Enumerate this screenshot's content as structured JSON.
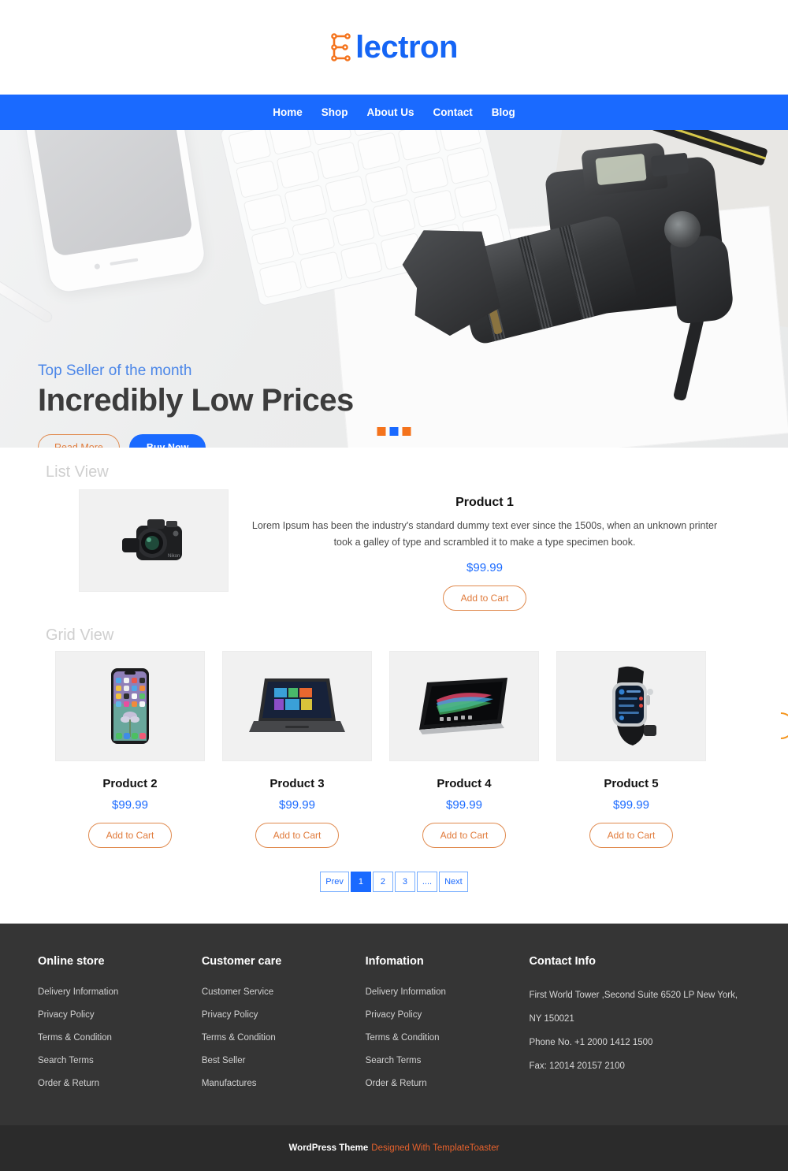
{
  "header": {
    "logo_text": "lectron",
    "logo_icon": "circuit-e-icon"
  },
  "nav": {
    "items": [
      "Home",
      "Shop",
      "About Us",
      "Contact",
      "Blog"
    ]
  },
  "hero": {
    "eyebrow": "Top Seller of the month",
    "title": "Incredibly Low Prices",
    "read_more": "Read More",
    "buy_now": "Buy Now",
    "slides": 3,
    "active_slide": 2
  },
  "list_view": {
    "label": "List View",
    "product": {
      "name": "Product 1",
      "description": "Lorem Ipsum has been the industry's standard dummy text ever since the 1500s, when an unknown printer took a galley of type and scrambled it to make a type specimen book.",
      "price": "$99.99",
      "cart_label": "Add to Cart",
      "image": "dslr-camera-image"
    }
  },
  "grid_view": {
    "label": "Grid View",
    "products": [
      {
        "name": "Product 2",
        "price": "$99.99",
        "cart_label": "Add to Cart",
        "image": "smartphone-image"
      },
      {
        "name": "Product 3",
        "price": "$99.99",
        "cart_label": "Add to Cart",
        "image": "laptop-image"
      },
      {
        "name": "Product 4",
        "price": "$99.99",
        "cart_label": "Add to Cart",
        "image": "tablet-image"
      },
      {
        "name": "Product 5",
        "price": "$99.99",
        "cart_label": "Add to Cart",
        "image": "smartwatch-image"
      }
    ]
  },
  "pagination": {
    "items": [
      "Prev",
      "1",
      "2",
      "3",
      "....",
      "Next"
    ],
    "active": "1"
  },
  "footer": {
    "columns": [
      {
        "title": "Online store",
        "links": [
          "Delivery Information",
          "Privacy Policy",
          "Terms & Condition",
          "Search Terms",
          "Order & Return"
        ]
      },
      {
        "title": "Customer care",
        "links": [
          "Customer Service",
          "Privacy Policy",
          "Terms & Condition",
          "Best Seller",
          "Manufactures"
        ]
      },
      {
        "title": "Infomation",
        "links": [
          "Delivery Information",
          "Privacy Policy",
          "Terms & Condition",
          "Search Terms",
          "Order & Return"
        ]
      }
    ],
    "contact": {
      "title": "Contact Info",
      "address_line1": "First World Tower ,Second Suite 6520 LP New York,",
      "address_line2": "NY 150021",
      "phone": "Phone No. +1 2000 1412 1500",
      "fax": "Fax: 12014 20157 2100"
    }
  },
  "copyright": {
    "prefix": "WordPress Theme",
    "link": "Designed With TemplateToaster"
  },
  "colors": {
    "brand_blue": "#1a6aff",
    "brand_orange": "#f4731c",
    "accent_orange": "#e07a3a",
    "footer_bg": "#353535",
    "copyright_bg": "#2b2b2b"
  }
}
